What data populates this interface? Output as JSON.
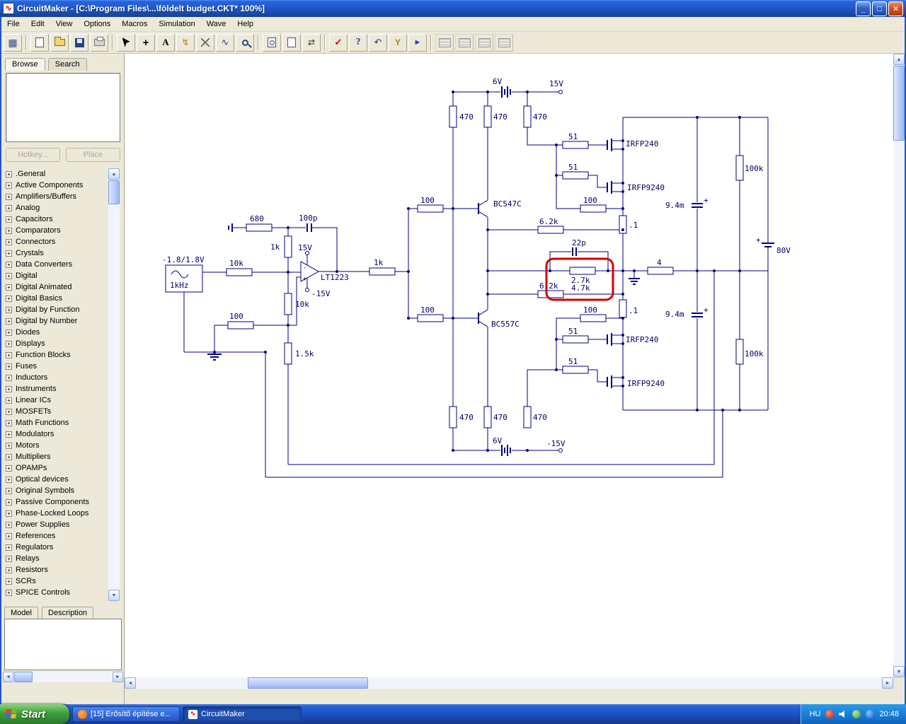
{
  "window": {
    "title": "CircuitMaker - [C:\\Program Files\\...\\földelt budget.CKT* 100%]",
    "controls": {
      "minimize": "_",
      "maximize": "□",
      "close": "×"
    }
  },
  "menu": {
    "items": [
      "File",
      "Edit",
      "View",
      "Options",
      "Macros",
      "Simulation",
      "Wave",
      "Help"
    ]
  },
  "toolbar": {
    "glyphs": {
      "panel": "▦",
      "plus": "+",
      "text": "A",
      "bolt": "↯",
      "wave": "∿",
      "split": "⇄",
      "check": "✓",
      "help": "?",
      "rotate": "↶",
      "probe": "Y",
      "run": "►"
    }
  },
  "sidebar": {
    "tabs": [
      "Browse",
      "Search"
    ],
    "hotkey_label": "Hotkey...",
    "place_label": "Place",
    "expander_glyph": "+",
    "categories": [
      ".General",
      "Active Components",
      "Amplifiers/Buffers",
      "Analog",
      "Capacitors",
      "Comparators",
      "Connectors",
      "Crystals",
      "Data Converters",
      "Digital",
      "Digital Animated",
      "Digital Basics",
      "Digital by Function",
      "Digital by Number",
      "Diodes",
      "Displays",
      "Function Blocks",
      "Fuses",
      "Inductors",
      "Instruments",
      "Linear ICs",
      "MOSFETs",
      "Math Functions",
      "Modulators",
      "Motors",
      "Multipliers",
      "OPAMPs",
      "Optical devices",
      "Original Symbols",
      "Passive Components",
      "Phase-Locked Loops",
      "Power Supplies",
      "References",
      "Regulators",
      "Relays",
      "Resistors",
      "SCRs",
      "SPICE Controls"
    ],
    "bottom_tabs": [
      "Model",
      "Description"
    ]
  },
  "canvas": {
    "labels": {
      "src_range": "-1.8/1.8V",
      "src_freq": "1kHz",
      "r_in": "10k",
      "r680": "680",
      "c100p": "100p",
      "r1k_fb": "1k",
      "vp": "15V",
      "vn": "-15V",
      "op_minus": "-",
      "op_plus": "+",
      "opamp": "LT1223",
      "r10k2": "10k",
      "r100_in": "100",
      "r1k5": "1.5k",
      "r1k_out": "1k",
      "bat6_t": "6V",
      "v15_t": "15V",
      "r470_t1": "470",
      "r470_t2": "470",
      "r470_t3": "470",
      "r51_t1": "51",
      "r51_t2": "51",
      "q240_t": "IRFP240",
      "q9240_t": "IRFP9240",
      "r100_b1": "100",
      "bc547": "BC547C",
      "r62k_t": "6.2k",
      "r100_g1": "100",
      "rp1_t": ".1",
      "c94m_t": "9.4m",
      "plus_t": "+",
      "r100k_t": "100k",
      "c22p": "22p",
      "r27k": "2.7k",
      "r47k": "4.7k",
      "r4": "4",
      "rp1_b": ".1",
      "r62k_b": "6.2k",
      "bc557": "BC557C",
      "r100_b2": "100",
      "r100_g2": "100",
      "r51_b1": "51",
      "r51_b2": "51",
      "q240_b": "IRFP240",
      "q9240_b": "IRFP9240",
      "c94m_b": "9.4m",
      "plus_b": "+",
      "r100k_b": "100k",
      "r470_b1": "470",
      "r470_b2": "470",
      "r470_b3": "470",
      "bat6_b": "6V",
      "vm15_b": "-15V",
      "bat80": "80V",
      "plus80": "+"
    }
  },
  "taskbar": {
    "start_label": "Start",
    "tasks": [
      "[15] Erősítő építése e...",
      "CircuitMaker"
    ],
    "tray": {
      "lang": "HU",
      "time": "20:48"
    }
  }
}
